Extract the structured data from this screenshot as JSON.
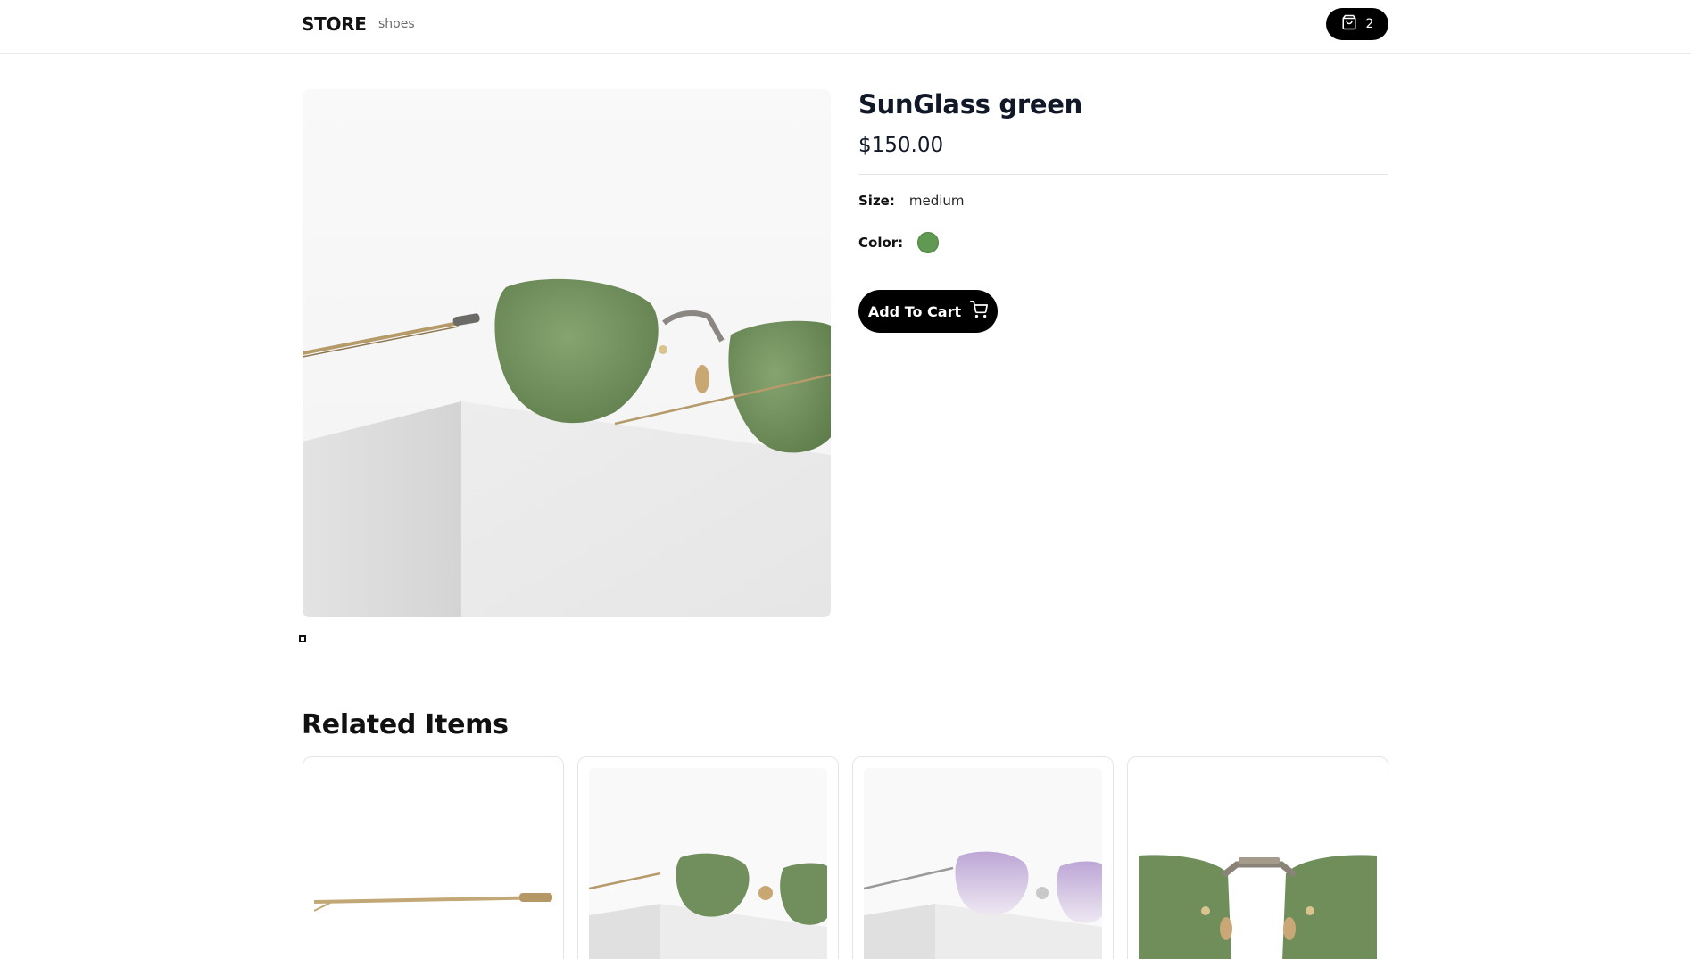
{
  "nav": {
    "logo": "STORE",
    "links": [
      "shoes"
    ],
    "cart_count": "2",
    "cart_icon": "shopping-bag-icon"
  },
  "product": {
    "title": "SunGlass green",
    "price": "$150.00",
    "size_label": "Size:",
    "size_value": "medium",
    "color_label": "Color:",
    "color_value": "#609a52",
    "add_to_cart_label": "Add To Cart",
    "add_to_cart_icon": "cart-icon"
  },
  "related": {
    "title": "Related Items",
    "items": [
      {
        "image": "sunglass-temple-arm"
      },
      {
        "image": "sunglass-green-pedestal"
      },
      {
        "image": "sunglass-purple-pedestal"
      },
      {
        "image": "sunglass-green-front"
      }
    ]
  },
  "colors": {
    "accent": "#000000",
    "lens_green": "#7a9a62",
    "lens_purple": "#c4b3d6",
    "frame_gold": "#b59a6a"
  }
}
